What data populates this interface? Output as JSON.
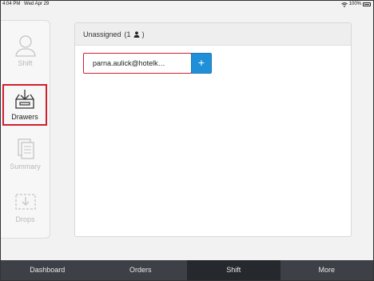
{
  "status_bar": {
    "time": "4:04 PM",
    "date": "Wed Apr 29",
    "battery": "100%"
  },
  "sidebar": {
    "items": [
      {
        "label": "Shift",
        "icon": "person-icon",
        "selected": false
      },
      {
        "label": "Drawers",
        "icon": "drawer-icon",
        "selected": true
      },
      {
        "label": "Summary",
        "icon": "document-icon",
        "selected": false
      },
      {
        "label": "Drops",
        "icon": "drop-tray-icon",
        "selected": false
      }
    ]
  },
  "panel": {
    "title": "Unassigned",
    "count": "(1",
    "count_close": ")",
    "user_value": "parna.aulick@hotelk…",
    "add_label": "+"
  },
  "tabs": [
    {
      "label": "Dashboard",
      "active": false
    },
    {
      "label": "Orders",
      "active": false
    },
    {
      "label": "Shift",
      "active": true
    },
    {
      "label": "More",
      "active": false
    }
  ],
  "colors": {
    "accent_blue": "#1f8fd8",
    "selection_red": "#d0202f",
    "tab_bar": "#3d4046"
  }
}
